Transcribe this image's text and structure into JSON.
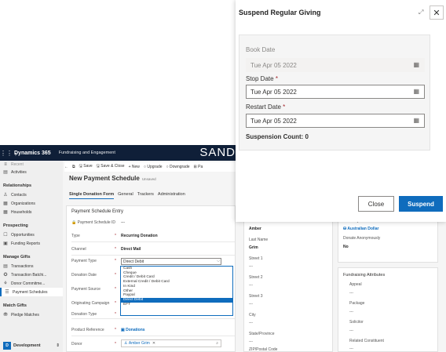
{
  "topbar": {
    "brand": "Dynamics 365",
    "app": "Fundraising and Engagement",
    "env": "SAND"
  },
  "sidebar": {
    "items_top": [
      {
        "icon": "recent-icon",
        "label": "Recent"
      },
      {
        "icon": "activities-icon",
        "label": "Activities"
      }
    ],
    "groups": [
      {
        "title": "Relationships",
        "items": [
          {
            "icon": "contact-icon",
            "label": "Contacts"
          },
          {
            "icon": "org-icon",
            "label": "Organizations"
          },
          {
            "icon": "household-icon",
            "label": "Households"
          }
        ]
      },
      {
        "title": "Prospecting",
        "items": [
          {
            "icon": "opportunity-icon",
            "label": "Opportunities"
          },
          {
            "icon": "report-icon",
            "label": "Funding Reports"
          }
        ]
      },
      {
        "title": "Manage Gifts",
        "items": [
          {
            "icon": "transaction-icon",
            "label": "Transactions"
          },
          {
            "icon": "batch-icon",
            "label": "Transaction Batchi..."
          },
          {
            "icon": "donor-icon",
            "label": "Donor Commitme..."
          },
          {
            "icon": "schedule-icon",
            "label": "Payment Schedules"
          }
        ]
      },
      {
        "title": "Match Gifts",
        "items": [
          {
            "icon": "pledge-icon",
            "label": "Pledge Matches"
          }
        ]
      }
    ],
    "area": {
      "badge": "D",
      "label": "Development"
    }
  },
  "cmdbar": {
    "back": "←",
    "popout": "⧉",
    "save": "Save",
    "save_close": "Save & Close",
    "new": "New",
    "upgrade": "Upgrade",
    "downgrade": "Downgrade",
    "more": "Pa"
  },
  "page": {
    "title": "New Payment Schedule",
    "status": "Unsaved"
  },
  "tabs": [
    "Single Donation Form",
    "General",
    "Trackers",
    "Administration"
  ],
  "card": {
    "title": "Payment Schedule Entry",
    "id_label": "Payment Schedule ID",
    "id_value": "---",
    "type_label": "Type",
    "type_value": "Recurring Donation",
    "channel_label": "Channel",
    "channel_value": "Direct Mail",
    "ptype_label": "Payment Type",
    "ptype_value": "Direct Debit",
    "ddate_label": "Donation Date",
    "psource_label": "Payment Source",
    "campaign_label": "Originating Campaign",
    "dtype_label": "Donation Type",
    "dtype_value": "Recurring Donation",
    "ref_label": "Product Reference",
    "ref_value": "Donations",
    "donor_label": "Donor",
    "donor_value": "Amber Grim"
  },
  "dropdown": [
    "Cash",
    "Cheque",
    "Credit / Debit Card",
    "External Credit / Debit Card",
    "In Kind",
    "Other",
    "Paypal",
    "Direct Debit",
    "EFT"
  ],
  "dropdown_selected": 7,
  "bgpanel": {
    "first_name_label": "First Name",
    "first_name": "Amber",
    "last_name_label": "Last Name",
    "last_name": "Grim",
    "street1": "Street 1",
    "street2": "Street 2",
    "street3": "Street 3",
    "city": "City",
    "state": "State/Province",
    "zip": "ZIP/Postal Code",
    "dash": "---",
    "currency_label": "Currency",
    "currency": "Australian Dollar",
    "anon_label": "Donate Anonymously",
    "anon": "No",
    "attr_title": "Fundraising Attributes",
    "appeal": "Appeal",
    "package": "Package",
    "solicitor": "Solicitor",
    "constituent": "Related Constituent"
  },
  "dialog": {
    "title": "Suspend Regular Giving",
    "book_label": "Book Date",
    "book_value": "Tue Apr 05 2022",
    "stop_label": "Stop Date",
    "stop_value": "Tue Apr 05 2022",
    "restart_label": "Restart Date",
    "restart_value": "Tue Apr 05 2022",
    "required_mark": "*",
    "count": "Suspension Count: 0",
    "close_label": "Close",
    "suspend_label": "Suspend"
  },
  "colors": {
    "accent": "#0f6cbd",
    "nav": "#0f1f38",
    "required": "#a4262c"
  }
}
